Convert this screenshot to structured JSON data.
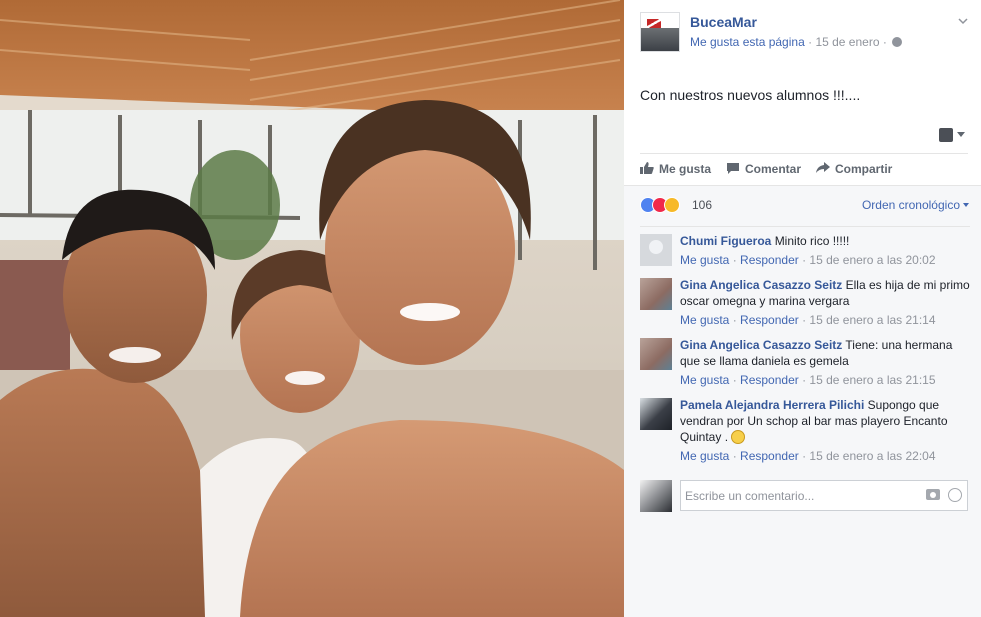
{
  "photo": {
    "description_icon": "selfie-photo"
  },
  "post": {
    "page_name": "BuceaMar",
    "like_page": "Me gusta esta página",
    "date": "15 de enero",
    "text": "Con nuestros nuevos alumnos !!!....",
    "audience_icon": "user-icon"
  },
  "actions": {
    "like": "Me gusta",
    "comment": "Comentar",
    "share": "Compartir"
  },
  "reactions": {
    "count": "106",
    "order": "Orden cronológico"
  },
  "comments": [
    {
      "author": "Chumi Figueroa",
      "text": "Minito rico !!!!!",
      "like": "Me gusta",
      "reply": "Responder",
      "time": "15 de enero a las 20:02"
    },
    {
      "author": "Gina Angelica Casazzo Seitz",
      "text": "Ella es hija de mi primo oscar omegna y marina vergara",
      "like": "Me gusta",
      "reply": "Responder",
      "time": "15 de enero a las 21:14"
    },
    {
      "author": "Gina Angelica Casazzo Seitz",
      "text": "Tiene: una hermana que se llama daniela es gemela",
      "like": "Me gusta",
      "reply": "Responder",
      "time": "15 de enero a las 21:15"
    },
    {
      "author": "Pamela Alejandra Herrera Pilichi",
      "text": "Supongo que vendran por Un schop al bar mas playero Encanto Quintay .",
      "like": "Me gusta",
      "reply": "Responder",
      "time": "15 de enero a las 22:04"
    }
  ],
  "composer": {
    "placeholder": "Escribe un comentario..."
  },
  "colors": {
    "link": "#365899",
    "accent": "#4267b2",
    "muted": "#90949c"
  }
}
